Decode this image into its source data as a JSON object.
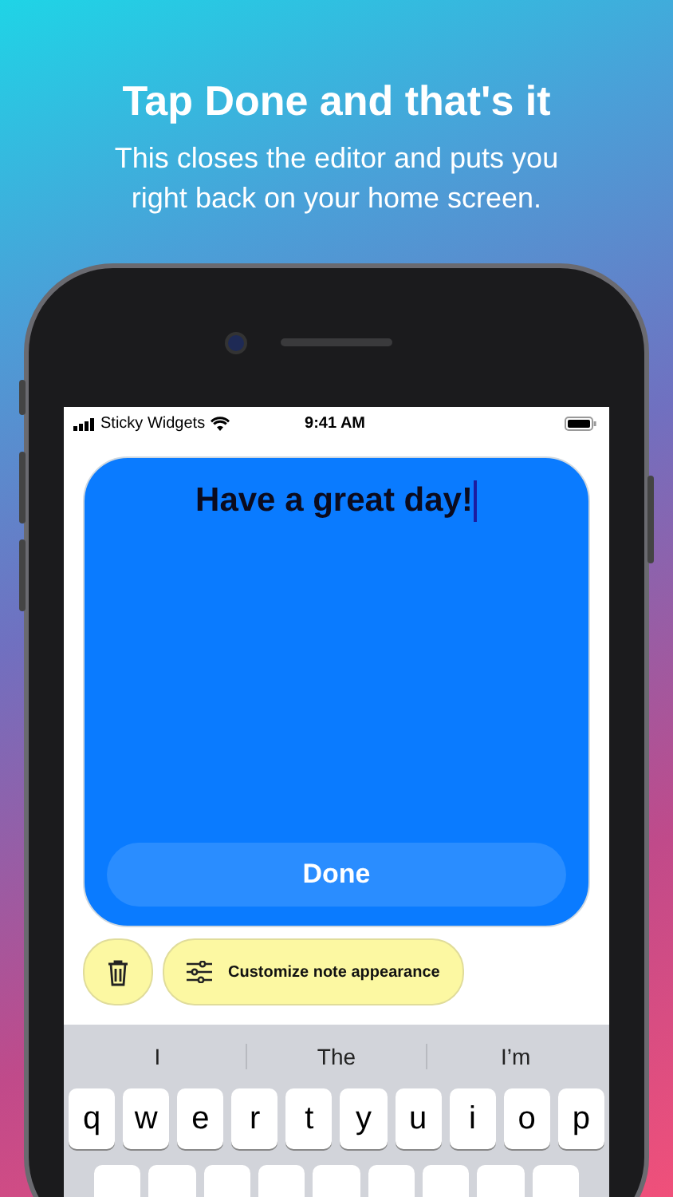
{
  "header": {
    "title": "Tap Done and that's it",
    "subtitle": "This closes the editor and puts you right back on your home screen."
  },
  "status_bar": {
    "carrier": "Sticky Widgets",
    "time": "9:41 AM"
  },
  "note": {
    "text": "Have a great day!",
    "done_label": "Done"
  },
  "actions": [
    {
      "kind": "trash"
    },
    {
      "kind": "customize",
      "label": "Customize note appearance"
    }
  ],
  "keyboard": {
    "suggestions": [
      "I",
      "The",
      "I’m"
    ],
    "row_1": [
      "q",
      "w",
      "e",
      "r",
      "t",
      "y",
      "u",
      "i",
      "o",
      "p"
    ]
  }
}
